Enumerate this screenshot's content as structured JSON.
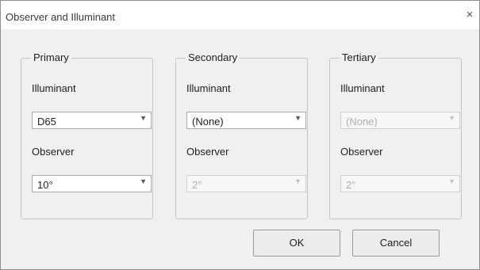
{
  "window": {
    "title": "Observer and Illuminant",
    "close_label": "×"
  },
  "groups": [
    {
      "title": "Primary",
      "illuminant_label": "Illuminant",
      "illuminant_value": "D65",
      "observer_label": "Observer",
      "observer_value": "10°"
    },
    {
      "title": "Secondary",
      "illuminant_label": "Illuminant",
      "illuminant_value": "(None)",
      "observer_label": "Observer",
      "observer_value": "2°"
    },
    {
      "title": "Tertiary",
      "illuminant_label": "Illuminant",
      "illuminant_value": "(None)",
      "observer_label": "Observer",
      "observer_value": "2°"
    }
  ],
  "dropdown_arrow": "▼",
  "buttons": {
    "ok": "OK",
    "cancel": "Cancel"
  }
}
